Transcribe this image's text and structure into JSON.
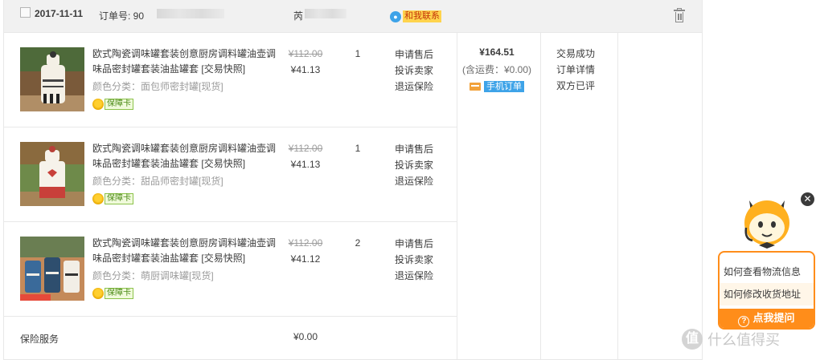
{
  "header": {
    "date": "2017-11-11",
    "order_no_label": "订单号: 90",
    "shop_name": "芮",
    "contact_label": "和我联系"
  },
  "items": [
    {
      "title": "欧式陶瓷调味罐套装创意厨房调料罐油壶调味品密封罐套装油盐罐套",
      "snapshot": "[交易快照]",
      "sku": "颜色分类：面包师密封罐[现货]",
      "guarantee": "保障卡",
      "price_original": "¥112.00",
      "price_now": "¥41.13",
      "qty": "1",
      "ops": [
        "申请售后",
        "投诉卖家",
        "退运保险"
      ]
    },
    {
      "title": "欧式陶瓷调味罐套装创意厨房调料罐油壶调味品密封罐套装油盐罐套",
      "snapshot": "[交易快照]",
      "sku": "颜色分类：甜品师密封罐[现货]",
      "guarantee": "保障卡",
      "price_original": "¥112.00",
      "price_now": "¥41.13",
      "qty": "1",
      "ops": [
        "申请售后",
        "投诉卖家",
        "退运保险"
      ]
    },
    {
      "title": "欧式陶瓷调味罐套装创意厨房调料罐油壶调味品密封罐套装油盐罐套",
      "snapshot": "[交易快照]",
      "sku": "颜色分类：萌厨调味罐[现货]",
      "guarantee": "保障卡",
      "price_original": "¥112.00",
      "price_now": "¥41.12",
      "qty": "2",
      "ops": [
        "申请售后",
        "投诉卖家",
        "退运保险"
      ]
    }
  ],
  "insurance": {
    "label": "保险服务",
    "price": "¥0.00"
  },
  "total": {
    "amount": "¥164.51",
    "shipping": "(含运费：¥0.00)",
    "mobile_order": "手机订单"
  },
  "status": [
    "交易成功",
    "订单详情",
    "双方已评"
  ],
  "chat": {
    "faq": [
      "如何查看物流信息",
      "如何修改收货地址"
    ],
    "ask_button": "点我提问"
  },
  "watermark": {
    "logo": "值",
    "text": "什么值得买"
  },
  "colors": {
    "accent_orange": "#ff8d1a",
    "contact_yellow": "#ffd44d",
    "mobile_blue": "#3ea3e8"
  }
}
